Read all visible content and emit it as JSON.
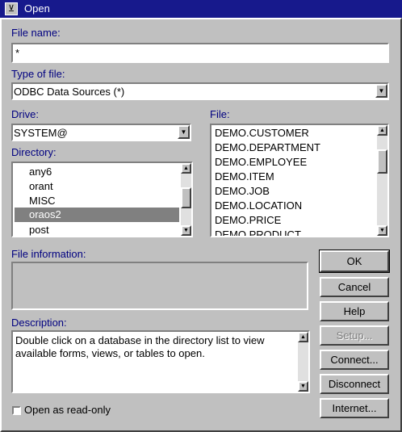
{
  "window": {
    "title": "Open"
  },
  "file_name": {
    "label": "File name:",
    "value": "*"
  },
  "type_of_file": {
    "label": "Type of file:",
    "value": "ODBC Data Sources (*)"
  },
  "drive": {
    "label": "Drive:",
    "value": "SYSTEM@"
  },
  "directory": {
    "label": "Directory:",
    "items": [
      "any6",
      "orant",
      "MISC",
      "oraos2",
      "post"
    ],
    "selected": "oraos2"
  },
  "file": {
    "label": "File:",
    "items": [
      "DEMO.CUSTOMER",
      "DEMO.DEPARTMENT",
      "DEMO.EMPLOYEE",
      "DEMO.ITEM",
      "DEMO.JOB",
      "DEMO.LOCATION",
      "DEMO.PRICE",
      "DEMO.PRODUCT"
    ]
  },
  "file_information": {
    "label": "File information:"
  },
  "description": {
    "label": "Description:",
    "text": "Double click on a database in the directory list to view available forms, views, or tables to open."
  },
  "buttons": {
    "ok": "OK",
    "cancel": "Cancel",
    "help": "Help",
    "setup": "Setup...",
    "connect": "Connect...",
    "disconnect": "Disconnect",
    "internet": "Internet..."
  },
  "read_only": {
    "label": "Open as read-only",
    "checked": false
  },
  "colors": {
    "titlebar": "#17198c",
    "selection": "#808080",
    "label_text": "#000080",
    "dialog_bg": "#c0c0c0"
  }
}
